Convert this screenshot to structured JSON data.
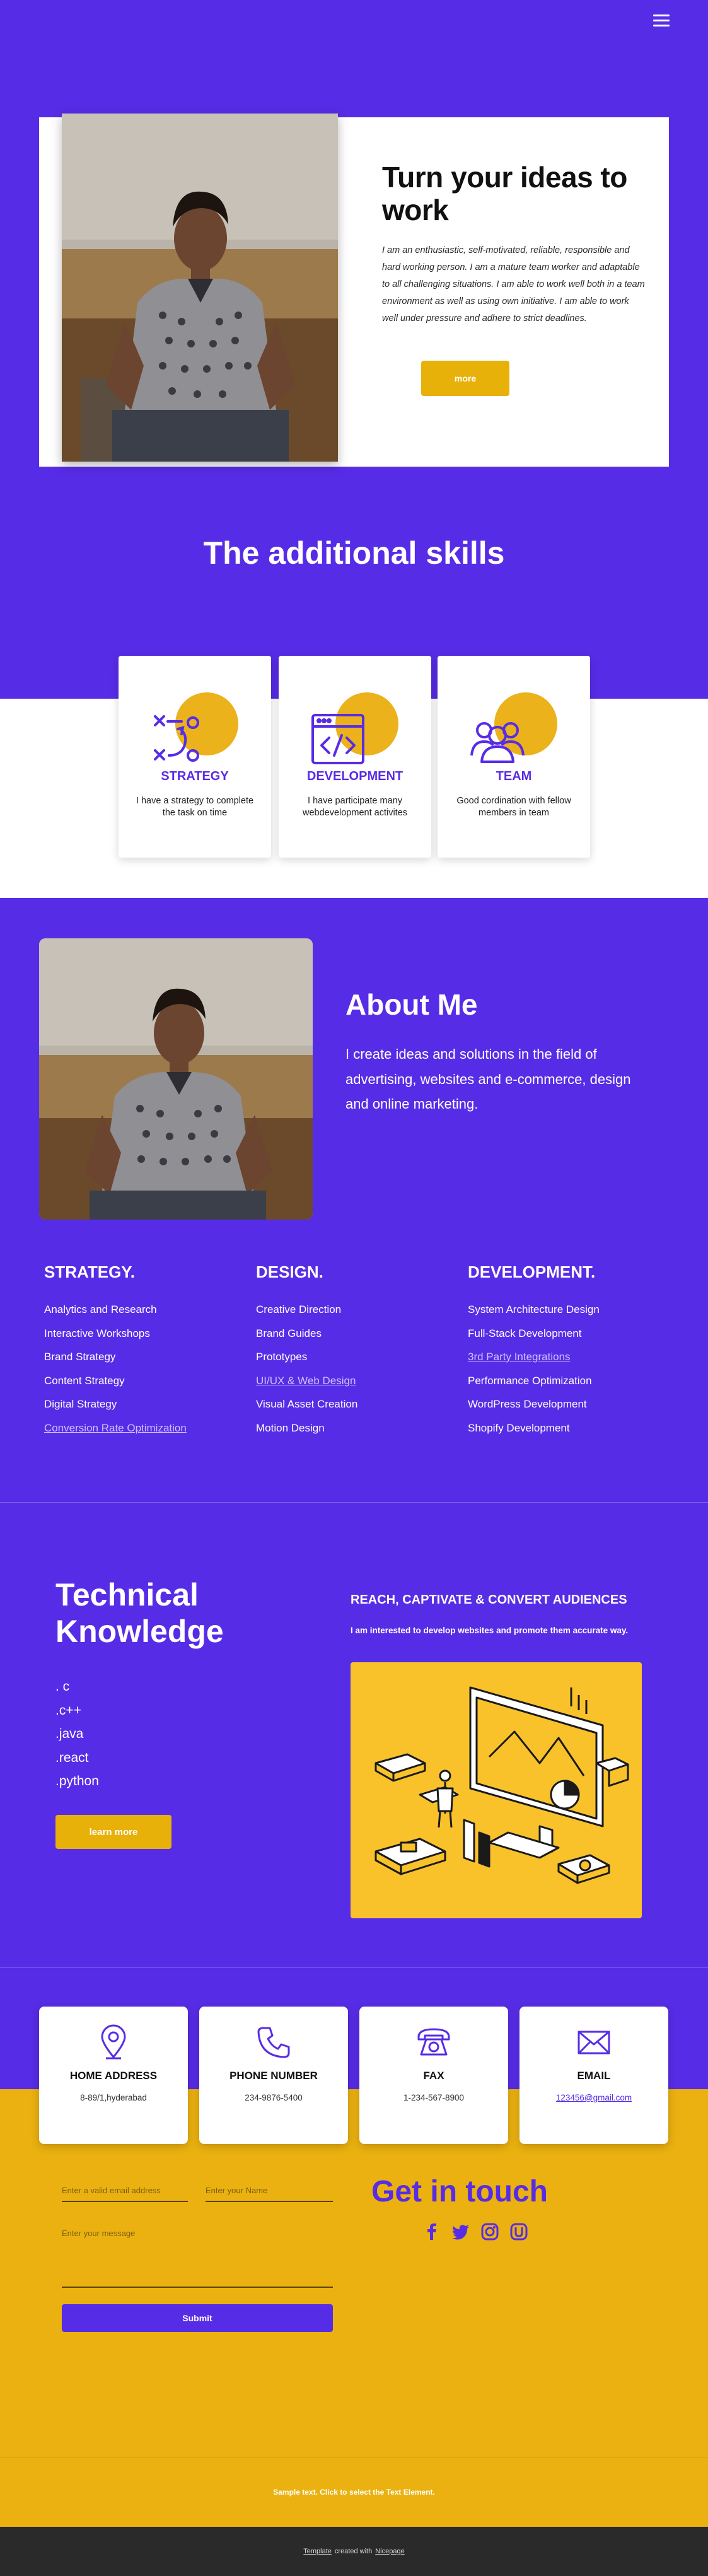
{
  "hero": {
    "title": "Turn your ideas to\n work",
    "description": "I am an enthusiastic, self-motivated, reliable, responsible and hard working person. I am a mature team worker and adaptable to all challenging situations. I am able to work well both in a team environment as well as using own initiative. I am able to work well under pressure and adhere to strict deadlines.",
    "button": "more"
  },
  "skills": {
    "heading": "The additional skills",
    "cards": [
      {
        "title": "STRATEGY",
        "desc": "I have a strategy to complete the task on time",
        "icon": "strategy-icon"
      },
      {
        "title": "DEVELOPMENT",
        "desc": "I have participate many webdevelopment activites",
        "icon": "code-window-icon"
      },
      {
        "title": "TEAM",
        "desc": "Good cordination with fellow members in team",
        "icon": "team-icon"
      }
    ]
  },
  "about": {
    "title": "About Me",
    "description": "I create ideas and solutions in the field of advertising, websites and e-commerce, design and online marketing."
  },
  "columns": [
    {
      "title": "STRATEGY.",
      "items": [
        "Analytics and Research",
        "Interactive Workshops",
        "Brand Strategy",
        "Content Strategy",
        "Digital Strategy",
        "Conversion Rate Optimization"
      ]
    },
    {
      "title": "DESIGN.",
      "items": [
        "Creative Direction",
        "Brand Guides",
        "Prototypes",
        "UI/UX & Web Design",
        "Visual Asset Creation",
        "Motion Design"
      ]
    },
    {
      "title": "DEVELOPMENT.",
      "items": [
        "System Architecture Design",
        "Full-Stack Development",
        "3rd Party Integrations",
        "Performance Optimization",
        "WordPress Development",
        "Shopify Development"
      ]
    }
  ],
  "technical": {
    "title": "Technical\n Knowledge",
    "items": [
      ". c",
      ".c++",
      ".java",
      ".react",
      ".python"
    ],
    "button": "learn more",
    "reach_title": "REACH, CAPTIVATE & CONVERT AUDIENCES",
    "reach_desc": "I am interested to develop websites and promote them accurate way."
  },
  "contact": {
    "cards": [
      {
        "title": "HOME ADDRESS",
        "value": "8-89/1,hyderabad",
        "icon": "location-pin-icon"
      },
      {
        "title": "PHONE NUMBER",
        "value": "234-9876-5400",
        "icon": "phone-icon"
      },
      {
        "title": "FAX",
        "value": "1-234-567-8900",
        "icon": "fax-telephone-icon"
      },
      {
        "title": "EMAIL",
        "value": "123456@gmail.com",
        "icon": "envelope-icon"
      }
    ],
    "form": {
      "email_placeholder": "Enter a valid email address",
      "name_placeholder": "Enter your Name",
      "message_placeholder": "Enter your message",
      "submit": "Submit"
    },
    "get_in_touch": "Get in touch",
    "socials": [
      "facebook-icon",
      "twitter-icon",
      "instagram-icon",
      "social-u-icon"
    ]
  },
  "footer": {
    "sample_text": "Sample text. Click to select the Text Element.",
    "template_link": "Template",
    "created_with": "created with",
    "builder_link": "Nicepage"
  },
  "colors": {
    "primary": "#572ce6",
    "accent": "#ebb110",
    "footer_bg": "#2a2a2a"
  }
}
